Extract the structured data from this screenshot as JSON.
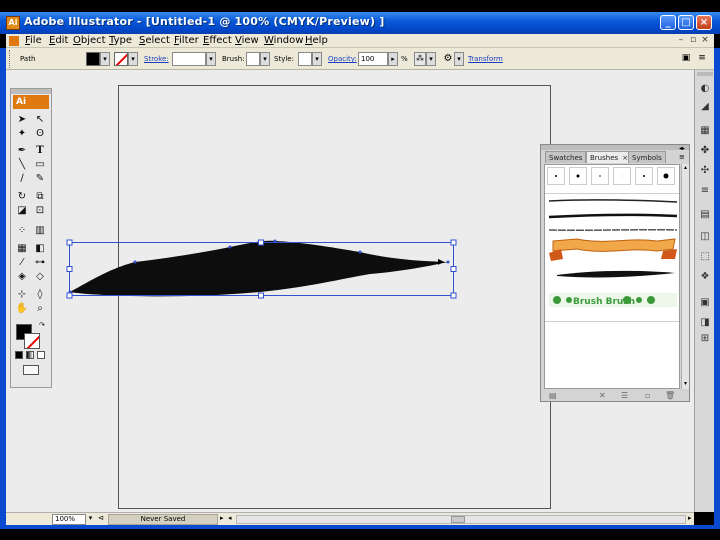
{
  "window": {
    "title": "Adobe Illustrator - [Untitled-1 @ 100% (CMYK/Preview) ]"
  },
  "menu": {
    "items": [
      "File",
      "Edit",
      "Object",
      "Type",
      "Select",
      "Filter",
      "Effect",
      "View",
      "Window",
      "Help"
    ]
  },
  "control": {
    "selection": "Path",
    "stroke_label": "Stroke:",
    "brush_label": "Brush:",
    "style_label": "Style:",
    "opacity_label": "Opacity:",
    "opacity_value": "100",
    "opacity_unit": "%",
    "transform_label": "Transform"
  },
  "toolbox": {
    "logo": "Ai"
  },
  "brushes_panel": {
    "tabs": [
      "Swatches",
      "Brushes",
      "Symbols"
    ],
    "active_tab": "Brushes",
    "close_tab": "×",
    "scatter_text": "Brush Brush"
  },
  "status": {
    "zoom": "100%",
    "doc_state": "Never Saved"
  },
  "colors": {
    "fill": "#000000",
    "selection": "#3050d0",
    "accent": "#e07a10"
  },
  "icons": {
    "titlebar": "illustrator-app-icon",
    "min": "minimize-icon",
    "max": "maximize-icon",
    "close": "close-icon"
  }
}
